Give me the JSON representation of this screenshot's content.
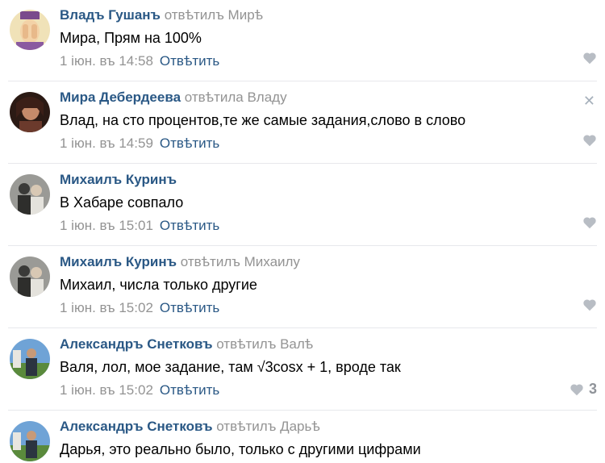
{
  "comments": [
    {
      "author": "Владъ Гушанъ",
      "reply_to": "отвѣтилъ Мирѣ",
      "text": "Мира, Прям на 100%",
      "date": "1 іюн. въ 14:58",
      "reply_label": "Отвѣтить",
      "likes": "",
      "avatar_icon": "face-palm-avatar"
    },
    {
      "author": "Мира Дебердеева",
      "reply_to": "отвѣтила Владу",
      "text": "Влад, на сто процентов,те же самые задания,слово в слово",
      "date": "1 іюн. въ 14:59",
      "reply_label": "Отвѣтить",
      "likes": "",
      "avatar_icon": "portrait-avatar"
    },
    {
      "author": "Михаилъ Куринъ",
      "reply_to": "",
      "text": "В Хабаре совпало",
      "date": "1 іюн. въ 15:01",
      "reply_label": "Отвѣтить",
      "likes": "",
      "avatar_icon": "group-photo-avatar"
    },
    {
      "author": "Михаилъ Куринъ",
      "reply_to": "отвѣтилъ Михаилу",
      "text": "Михаил, числа только другие",
      "date": "1 іюн. въ 15:02",
      "reply_label": "Отвѣтить",
      "likes": "",
      "avatar_icon": "group-photo-avatar"
    },
    {
      "author": "Александръ Снетковъ",
      "reply_to": "отвѣтилъ Валѣ",
      "text": "Валя, лол, мое задание, там √3cosx + 1, вроде так",
      "date": "1 іюн. въ 15:02",
      "reply_label": "Отвѣтить",
      "likes": "3",
      "avatar_icon": "outdoor-photo-avatar"
    },
    {
      "author": "Александръ Снетковъ",
      "reply_to": "отвѣтилъ Дарьѣ",
      "text": "Дарья, это реально было, только с другими цифрами",
      "date": "",
      "reply_label": "",
      "likes": "",
      "avatar_icon": "outdoor-photo-avatar"
    }
  ],
  "colors": {
    "author": "#2a5885",
    "muted": "#939393",
    "divider": "#e7e8ec",
    "like_icon": "#b8bdc4"
  }
}
